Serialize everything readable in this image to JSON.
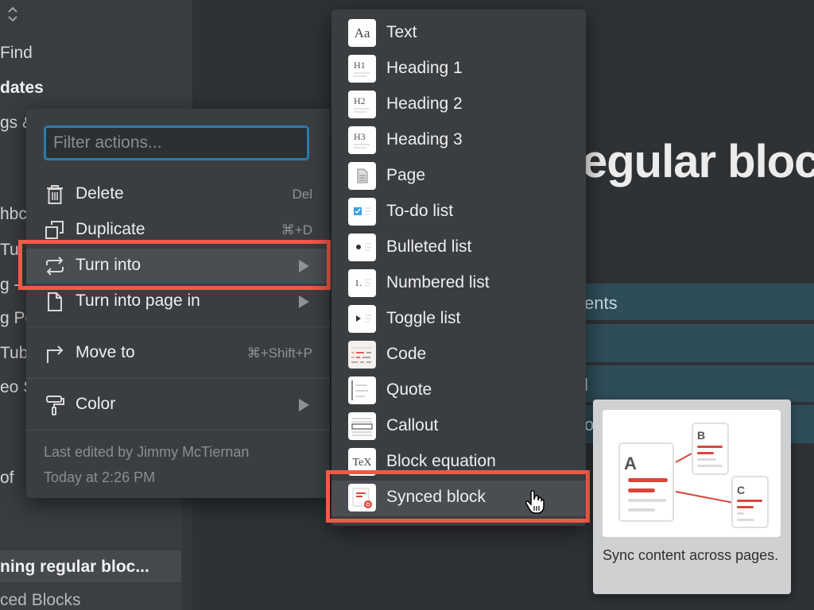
{
  "sidebar": {
    "items": [
      {
        "label": "Find"
      },
      {
        "label": "dates"
      },
      {
        "label": "gs &"
      },
      {
        "label": "hbc"
      },
      {
        "label": "Tu"
      },
      {
        "label": "g -"
      },
      {
        "label": "g Pc"
      },
      {
        "label": "Tub"
      },
      {
        "label": "eo S"
      },
      {
        "label": "of"
      }
    ],
    "active_page": "ning regular bloc...",
    "next_page": "ced Blocks"
  },
  "main": {
    "title_fragment": "egular bloc",
    "rows": [
      {
        "text": "ents"
      },
      {
        "text": ""
      },
      {
        "text": "l"
      },
      {
        "text": "o"
      }
    ]
  },
  "context_menu": {
    "filter": {
      "value": "",
      "placeholder": "Filter actions..."
    },
    "items": [
      {
        "icon": "trash-icon",
        "label": "Delete",
        "shortcut": "Del"
      },
      {
        "icon": "duplicate-icon",
        "label": "Duplicate",
        "shortcut": "⌘+D"
      },
      {
        "icon": "turn-into-icon",
        "label": "Turn into",
        "submenu": true,
        "highlighted": true
      },
      {
        "icon": "page-icon",
        "label": "Turn into page in",
        "submenu": true
      },
      {
        "icon": "move-to-icon",
        "label": "Move to",
        "shortcut": "⌘+Shift+P"
      },
      {
        "icon": "paint-roller-icon",
        "label": "Color",
        "submenu": true
      }
    ],
    "footer": {
      "last_edited": "Last edited by Jimmy McTiernan",
      "time": "Today at 2:26 PM"
    }
  },
  "turn_into_menu": {
    "items": [
      {
        "icon": "text-thumb-icon",
        "glyph": "Aa",
        "label": "Text"
      },
      {
        "icon": "heading1-thumb-icon",
        "glyph": "H1",
        "label": "Heading 1"
      },
      {
        "icon": "heading2-thumb-icon",
        "glyph": "H2",
        "label": "Heading 2"
      },
      {
        "icon": "heading3-thumb-icon",
        "glyph": "H3",
        "label": "Heading 3"
      },
      {
        "icon": "page-thumb-icon",
        "label": "Page"
      },
      {
        "icon": "todo-thumb-icon",
        "label": "To-do list"
      },
      {
        "icon": "bulleted-thumb-icon",
        "label": "Bulleted list"
      },
      {
        "icon": "numbered-thumb-icon",
        "glyph": "1.",
        "label": "Numbered list"
      },
      {
        "icon": "toggle-thumb-icon",
        "label": "Toggle list"
      },
      {
        "icon": "code-thumb-icon",
        "label": "Code"
      },
      {
        "icon": "quote-thumb-icon",
        "label": "Quote"
      },
      {
        "icon": "callout-thumb-icon",
        "label": "Callout"
      },
      {
        "icon": "tex-thumb-icon",
        "glyph": "TeX",
        "label": "Block equation"
      },
      {
        "icon": "synced-block-thumb-icon",
        "label": "Synced block",
        "highlighted": true
      }
    ]
  },
  "preview": {
    "labels": [
      "A",
      "B",
      "C"
    ],
    "caption": "Sync content across pages."
  },
  "colors": {
    "highlight": "#ef5a47",
    "focus_ring": "#2e7bab",
    "menu_bg": "#3b3e41",
    "synced_red": "#d9463a"
  }
}
